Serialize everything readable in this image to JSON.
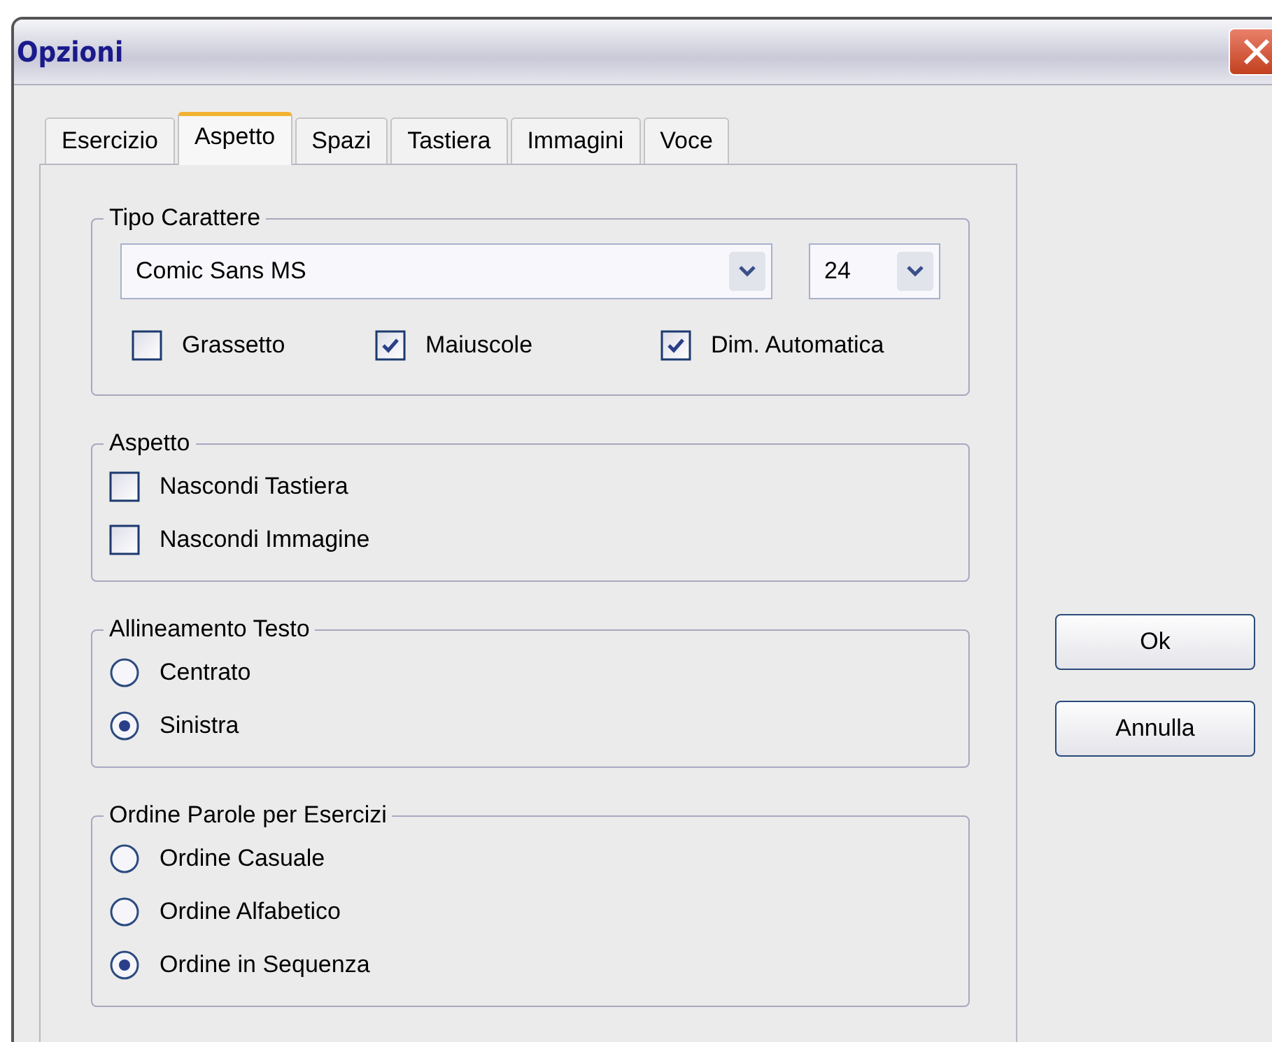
{
  "window": {
    "title": "Opzioni"
  },
  "tabs": [
    {
      "label": "Esercizio",
      "selected": false
    },
    {
      "label": "Aspetto",
      "selected": true
    },
    {
      "label": "Spazi",
      "selected": false
    },
    {
      "label": "Tastiera",
      "selected": false
    },
    {
      "label": "Immagini",
      "selected": false
    },
    {
      "label": "Voce",
      "selected": false
    }
  ],
  "groups": [
    {
      "title": "Tipo Carattere",
      "kind": "font",
      "font_select": {
        "value": "Comic Sans MS"
      },
      "size_select": {
        "value": "24"
      },
      "options": [
        {
          "label": "Grassetto",
          "checked": false
        },
        {
          "label": "Maiuscole",
          "checked": true
        },
        {
          "label": "Dim. Automatica",
          "checked": true
        }
      ]
    },
    {
      "title": "Aspetto",
      "kind": "checkboxes",
      "options": [
        {
          "label": "Nascondi Tastiera",
          "checked": false
        },
        {
          "label": "Nascondi Immagine",
          "checked": false
        }
      ]
    },
    {
      "title": "Allineamento Testo",
      "kind": "radios",
      "options": [
        {
          "label": "Centrato",
          "selected": false
        },
        {
          "label": "Sinistra",
          "selected": true
        }
      ]
    },
    {
      "title": "Ordine Parole per Esercizi",
      "kind": "radios",
      "options": [
        {
          "label": "Ordine Casuale",
          "selected": false
        },
        {
          "label": "Ordine Alfabetico",
          "selected": false
        },
        {
          "label": "Ordine in Sequenza",
          "selected": true
        }
      ]
    }
  ],
  "buttons": [
    "Ok",
    "Annulla"
  ]
}
